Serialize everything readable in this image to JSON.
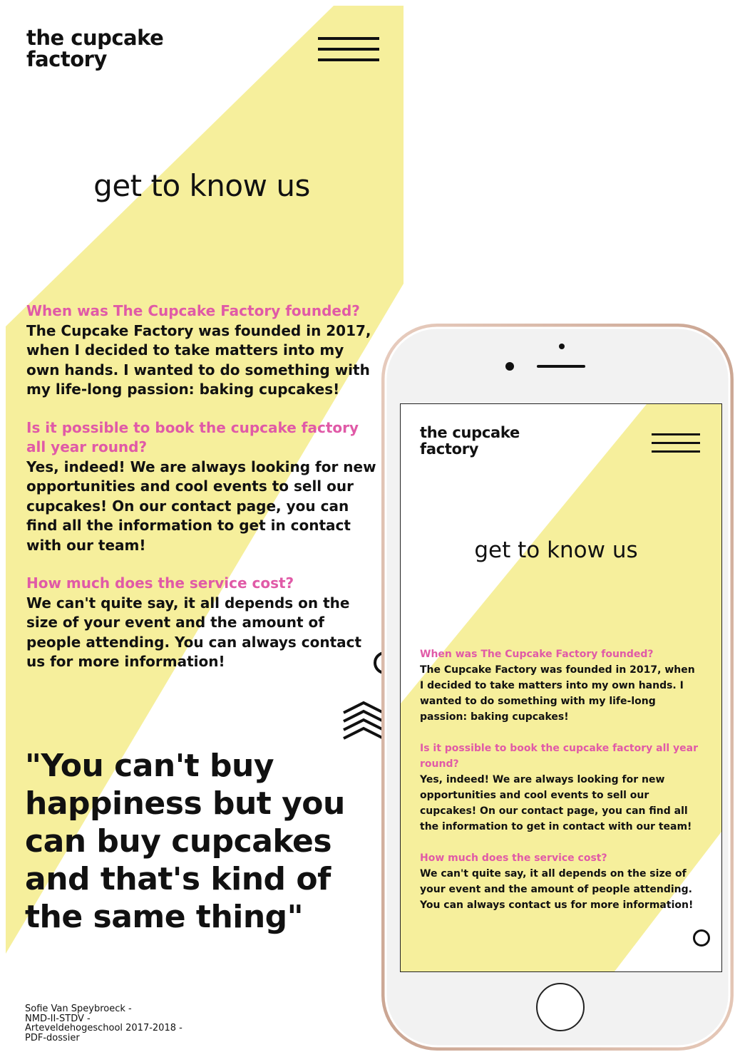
{
  "desktop": {
    "logo": "the cupcake\nfactory",
    "menu_icon": "hamburger-menu-icon",
    "title": "get to know us",
    "faq": [
      {
        "question": "When was The Cupcake Factory founded?",
        "answer": "The Cupcake Factory was founded in 2017, when I decided to take matters into my own hands. I wanted to do something with my life-long passion: baking cupcakes!"
      },
      {
        "question": "Is it possible to book the cupcake factory all year round?",
        "answer": "Yes, indeed! We are always looking for new opportunities and cool events to sell our cupcakes! On our contact page, you can find all the information to get in contact with our team!"
      },
      {
        "question": "How much does the service cost?",
        "answer": "We can't quite say, it all depends on the size of your event and the amount of people attending. You can always contact us for more information!"
      }
    ],
    "quote": "\"You can't buy happiness but you can buy cupcakes and that's kind of the same thing\""
  },
  "footer": "Sofie Van Speybroeck -\nNMD-II-STDV -\nArteveldehogeschool 2017-2018 -\nPDF-dossier",
  "phone": {
    "logo": "the cupcake\nfactory",
    "menu_icon": "hamburger-menu-icon",
    "title": "get to know us",
    "faq": [
      {
        "question": "When was The Cupcake Factory founded?",
        "answer": "The Cupcake Factory was founded in 2017, when I decided to take matters into my own hands. I wanted to do something with my life-long passion: baking cupcakes!"
      },
      {
        "question": "Is it possible to book the cupcake factory all year round?",
        "answer": "Yes, indeed! We are always looking for new opportunities and cool events to sell our cupcakes! On our contact page, you can find all the information to get in contact with our team!"
      },
      {
        "question": "How much does the service cost?",
        "answer": "We can't quite say, it all depends on the size of your event and the amount of people attending. You can always contact us for more information!"
      }
    ]
  },
  "colors": {
    "accent_yellow": "#f6ef9c",
    "question_pink": "#e05aa7",
    "text": "#111111",
    "phone_rose_gold": "#d9b8a6"
  }
}
